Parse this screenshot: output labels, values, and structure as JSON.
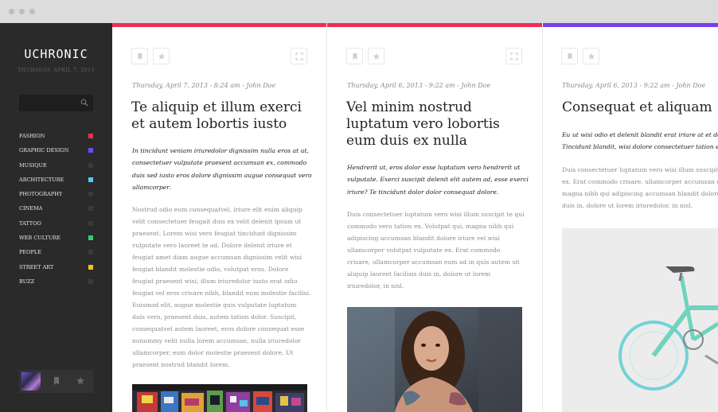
{
  "sidebar": {
    "logo": "UCHRONIC",
    "date": "THURSDAY, APRIL 7, 2013",
    "nav": [
      {
        "label": "FASHION",
        "color": "#ef2d56"
      },
      {
        "label": "GRAPHIC DESIGN",
        "color": "#6c4cf0"
      },
      {
        "label": "MUSIQUE",
        "color": ""
      },
      {
        "label": "ARCHITECTURE",
        "color": "#5bc7f0"
      },
      {
        "label": "PHOTOGRAPHY",
        "color": ""
      },
      {
        "label": "CINEMA",
        "color": ""
      },
      {
        "label": "TATTOO",
        "color": ""
      },
      {
        "label": "WEB CULTURE",
        "color": "#2ed46b"
      },
      {
        "label": "PEOPLE",
        "color": ""
      },
      {
        "label": "STREET ART",
        "color": "#f5c21b"
      },
      {
        "label": "BUZZ",
        "color": ""
      }
    ]
  },
  "articles": [
    {
      "accent": "#ef2d56",
      "meta": "Thursday, April 7, 2013 - 8:24 am - John Doe",
      "title": [
        "Te aliquip et illum exerci",
        "et autem lobortis iusto"
      ],
      "lead": [
        "In tincidunt veniam iriuredolor dignissim nulla eros at ut,",
        "consectetuer vulputate praesent accumsan ex, commodo",
        "duis sed iusto eros dolore dignissim augue consequat vero",
        "ullamcorper."
      ],
      "body": [
        "Nostrud odio eum consequatvel, iriure elit enim aliquip",
        "velit consectetuer feugait duis ex velit delenit ipsum ut",
        "praesent. Lorem wisi vero feugiat tincidunt dignissim",
        "vulputate vero laoreet te ad. Dolore delenit iriure et",
        "feugiat amet diam augue accumsan dignissim velit wisi",
        "feugiat blandit molestie odio, volutpat eros. Dolore",
        "feugiat praesent wisi, illum iriuredolor iusto erat odio",
        "feugiat vel eros crisare nibh, blandit eum molestie facilisi.",
        "Euismod elit, augue molestie quis vulputate luptatum",
        "duis vero, praesent duis, autem tation dolor. Suscipit,",
        "consequatvel autem laoreet, eros dolore consequat esse",
        "nonummy velit nulla lorem accumsan, nulla iriuredolor",
        "ullamcorper, eum dolor molestie praesent dolore. Ut",
        "praesent nostrud blandit lorem."
      ]
    },
    {
      "accent": "#ef2d56",
      "meta": "Thursday, April 6, 2013 - 9:22 am - John Doe",
      "title": [
        "Vel minim nostrud",
        "luptatum vero lobortis",
        "eum duis ex nulla"
      ],
      "lead": [
        "Hendrerit ut, eros dolor esse luptatum vero hendrerit ut",
        "vulputate. Exerci suscipit delenit elit autem ad, esse exerci",
        "iriure? Te tincidunt dolor dolor consequat dolore."
      ],
      "body": [
        "Duis consectetuer luptatum vero wisi illum suscipit te qui",
        "commodo vero tation ex. Volutpat qui, magna nibh qui",
        "adipiscing accumsan blandit dolore iriure vel wisi",
        "ullamcorper volutpat vulputate ex. Erat commodo",
        "crisare, ullamcorper accumsan eum ad in quis autem sit",
        "aliquip laoreet facilisis duis in, dolore ut lorem",
        "iriuredolor, in nisl."
      ]
    },
    {
      "accent": "#7b3df0",
      "meta": "Thursday, April 6, 2013 - 9:22 am - John Doe",
      "title": [
        "Consequat et aliquam"
      ],
      "lead": [
        "Eu ut wisi odio et delenit blandit erat iriure at et dolore",
        "Tincidunt blandit, wisi dolore consectetuer tation exerci"
      ],
      "body": [
        "Duis consectetuer luptatum vero wisi illum suscipit te qui",
        "ex. Erat commodo crisare, ullamcorper accumsan eum ad",
        "magna nibh qui adipiscing accumsan blandit dolore iriure",
        "duis in, dolore ut lorem iriuredolor, in nisl."
      ]
    }
  ]
}
